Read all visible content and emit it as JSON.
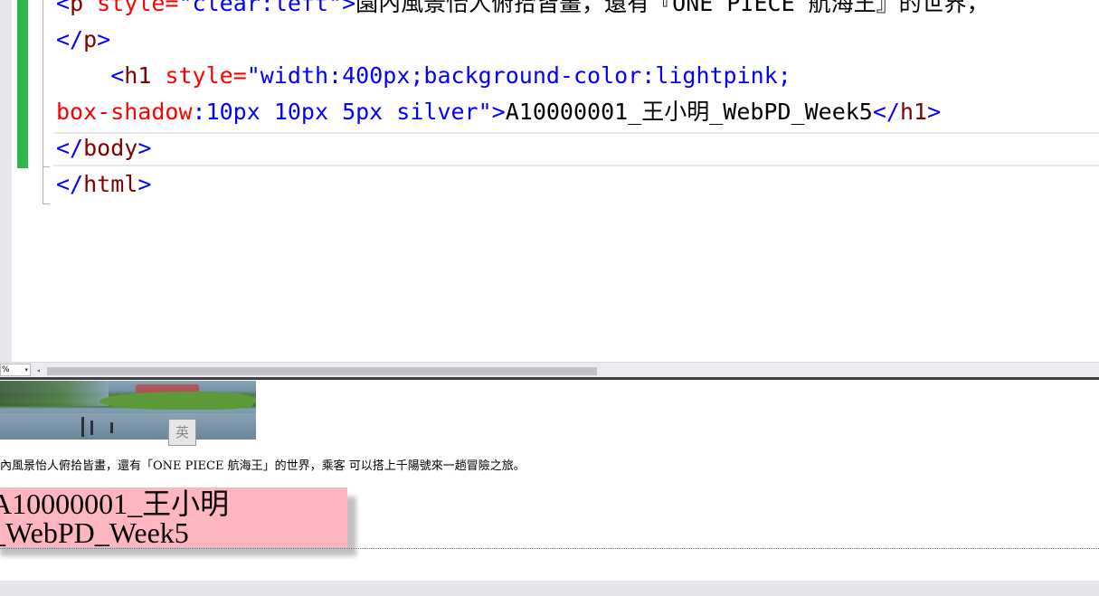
{
  "editor": {
    "line1": {
      "open": "<",
      "tag": "p",
      "attr": " style=",
      "value": "\"clear:left\"",
      "close": ">",
      "text": "園內風景怡人俯拾皆畫，還有『ONE PIECE 航海王』的世界，"
    },
    "line2": {
      "open": "</",
      "tag": "p",
      "close": ">"
    },
    "line3": {
      "indent": "    ",
      "open": "<",
      "tag": "h1",
      "attr": " style=",
      "value": "\"width:400px;background-color:lightpink;"
    },
    "line4": {
      "prop": "box-shadow",
      "rest": ":10px 10px 5px silver\"",
      "close": ">",
      "text": "A10000001_王小明_WebPD_Week5",
      "end_open": "</",
      "end_tag": "h1",
      "end_close": ">"
    },
    "line5": {
      "open": "</",
      "tag": "body",
      "close": ">"
    },
    "line6": {
      "open": "</",
      "tag": "html",
      "close": ">"
    }
  },
  "splitbar": {
    "zoom": "%",
    "zoom_arrow": "▾",
    "scroll_left": "◂"
  },
  "preview": {
    "ime_badge": "英",
    "paragraph": "內風景怡人俯拾皆畫，還有「ONE PIECE 航海王」的世界，乘客 可以搭上千陽號來一趟冒險之旅。",
    "heading_line1": "A10000001_王小明",
    "heading_line2": "_WebPD_Week5"
  },
  "colors": {
    "tag_bracket": "#0000ff",
    "tag_name": "#800000",
    "attribute": "#ff0000",
    "change_bar": "#2fb84a",
    "heading_bg": "#ffb6c1"
  }
}
